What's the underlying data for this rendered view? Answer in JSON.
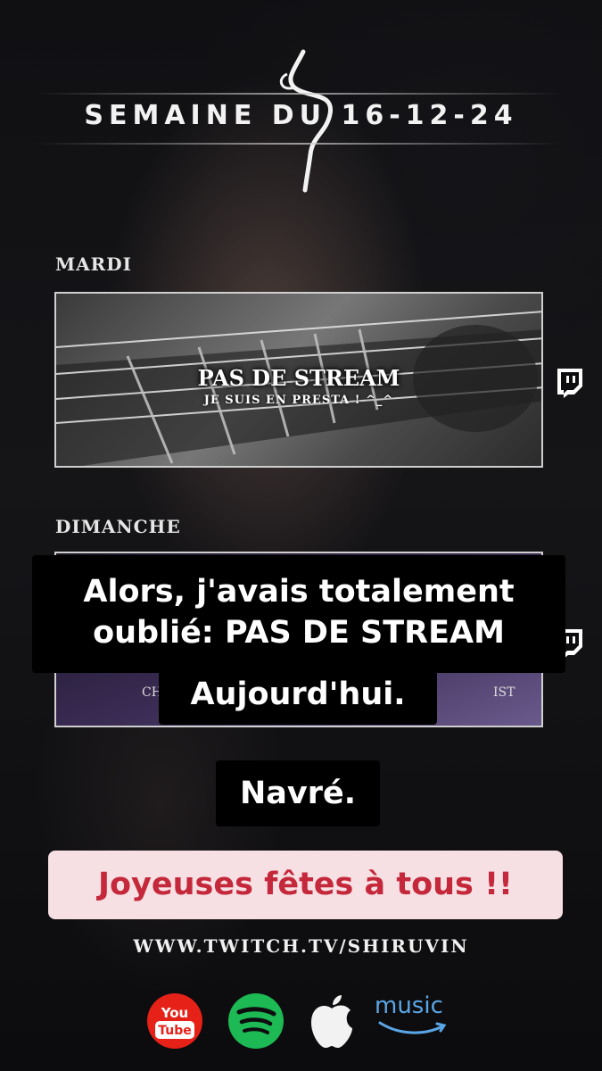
{
  "header": {
    "week_title": "SEMAINE DU 16-12-24"
  },
  "schedule": [
    {
      "day": "MARDI",
      "title": "PAS DE STREAM",
      "subtitle": "JE SUIS EN PRESTA ! ^_^"
    },
    {
      "day": "DIMANCHE",
      "partial_left": "CH",
      "partial_right": "IST"
    }
  ],
  "captions": {
    "line1": "Alors, j'avais totalement oublié: PAS DE STREAM",
    "line2": "Aujourd'hui.",
    "line3": "Navré.",
    "line4": "Joyeuses fêtes à tous !!"
  },
  "footer": {
    "url": "WWW.TWITCH.TV/SHIRUVIN",
    "youtube_label": "You Tube",
    "amazon_label": "music"
  },
  "icons": [
    "shiruvin-logo",
    "twitch-icon",
    "youtube-icon",
    "spotify-icon",
    "apple-icon",
    "amazon-music-icon"
  ],
  "colors": {
    "accent_red": "#c4283a",
    "caption_bg": "#000000",
    "highlight_bg": "#f6e0e4",
    "spotify_green": "#1db954",
    "youtube_red": "#e62117"
  }
}
